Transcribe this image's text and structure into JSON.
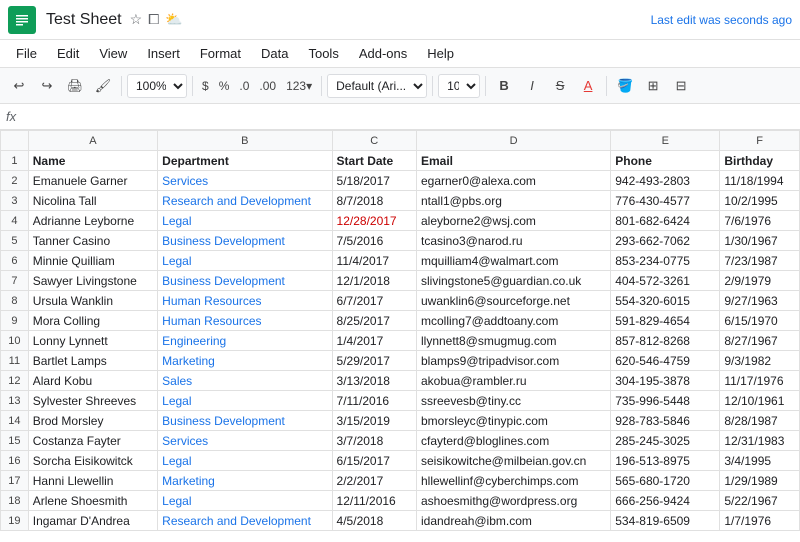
{
  "titleBar": {
    "title": "Test Sheet",
    "lastEdit": "Last edit was seconds ago"
  },
  "menuBar": {
    "items": [
      "File",
      "Edit",
      "View",
      "Insert",
      "Format",
      "Data",
      "Tools",
      "Add-ons",
      "Help"
    ]
  },
  "toolbar": {
    "zoom": "100%",
    "font": "Default (Ari...",
    "fontSize": "10"
  },
  "formulaBar": {
    "fx": "fx"
  },
  "sheet": {
    "columns": [
      "A",
      "B",
      "C",
      "D",
      "E",
      "F"
    ],
    "headers": [
      "Name",
      "Department",
      "Start Date",
      "Email",
      "Phone",
      "Birthday"
    ],
    "rows": [
      [
        "Emanuele Garner",
        "Services",
        "5/18/2017",
        "egarner0@alexa.com",
        "942-493-2803",
        "11/18/1994"
      ],
      [
        "Nicolina Tall",
        "Research and Development",
        "8/7/2018",
        "ntall1@pbs.org",
        "776-430-4577",
        "10/2/1995"
      ],
      [
        "Adrianne Leyborne",
        "Legal",
        "12/28/2017",
        "aleyborne2@wsj.com",
        "801-682-6424",
        "7/6/1976"
      ],
      [
        "Tanner Casino",
        "Business Development",
        "7/5/2016",
        "tcasino3@narod.ru",
        "293-662-7062",
        "1/30/1967"
      ],
      [
        "Minnie Quilliam",
        "Legal",
        "11/4/2017",
        "mquilliam4@walmart.com",
        "853-234-0775",
        "7/23/1987"
      ],
      [
        "Sawyer Livingstone",
        "Business Development",
        "12/1/2018",
        "slivingstone5@guardian.co.uk",
        "404-572-3261",
        "2/9/1979"
      ],
      [
        "Ursula Wanklin",
        "Human Resources",
        "6/7/2017",
        "uwanklin6@sourceforge.net",
        "554-320-6015",
        "9/27/1963"
      ],
      [
        "Mora Colling",
        "Human Resources",
        "8/25/2017",
        "mcolling7@addtoany.com",
        "591-829-4654",
        "6/15/1970"
      ],
      [
        "Lonny Lynnett",
        "Engineering",
        "1/4/2017",
        "llynnett8@smugmug.com",
        "857-812-8268",
        "8/27/1967"
      ],
      [
        "Bartlet Lamps",
        "Marketing",
        "5/29/2017",
        "blamps9@tripadvisor.com",
        "620-546-4759",
        "9/3/1982"
      ],
      [
        "Alard Kobu",
        "Sales",
        "3/13/2018",
        "akobua@rambler.ru",
        "304-195-3878",
        "11/17/1976"
      ],
      [
        "Sylvester Shreeves",
        "Legal",
        "7/11/2016",
        "ssreevesb@tiny.cc",
        "735-996-5448",
        "12/10/1961"
      ],
      [
        "Brod Morsley",
        "Business Development",
        "3/15/2019",
        "bmorsleyc@tinypic.com",
        "928-783-5846",
        "8/28/1987"
      ],
      [
        "Costanza Fayter",
        "Services",
        "3/7/2018",
        "cfayterd@bloglines.com",
        "285-245-3025",
        "12/31/1983"
      ],
      [
        "Sorcha Eisikowitck",
        "Legal",
        "6/15/2017",
        "seisikowitche@milbeian.gov.cn",
        "196-513-8975",
        "3/4/1995"
      ],
      [
        "Hanni Llewellin",
        "Marketing",
        "2/2/2017",
        "hllewellinf@cyberchimps.com",
        "565-680-1720",
        "1/29/1989"
      ],
      [
        "Arlene Shoesmith",
        "Legal",
        "12/11/2016",
        "ashoesmithg@wordpress.org",
        "666-256-9424",
        "5/22/1967"
      ],
      [
        "Ingamar D'Andrea",
        "Research and Development",
        "4/5/2018",
        "idandreah@ibm.com",
        "534-819-6509",
        "1/7/1976"
      ]
    ]
  }
}
